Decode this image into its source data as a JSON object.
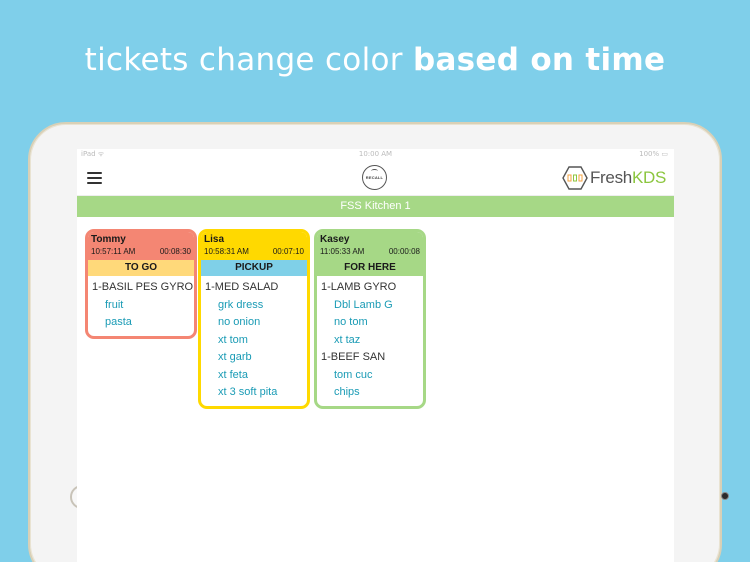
{
  "headline": {
    "normal": "tickets change color ",
    "bold": "based on time"
  },
  "statusbar": {
    "left": "iPad ᯤ",
    "center": "10:00 AM",
    "right": "100% ▭"
  },
  "navbar": {
    "recall_label": "RECALL",
    "brand_prefix": "Fresh",
    "brand_suffix": "KDS"
  },
  "kitchen": {
    "title": "FSS Kitchen 1"
  },
  "colors": {
    "red": "#f48673",
    "yellow": "#ffd900",
    "green": "#a6d886",
    "togo": "#ffd97a",
    "pickup": "#7fd0e8",
    "forhere": "#a6d886"
  },
  "tickets": [
    {
      "name": "Tommy",
      "time": "10:57:11 AM",
      "elapsed": "00:08:30",
      "type": "TO GO",
      "items": [
        {
          "name": "1-BASIL PES GYRO",
          "mods": [
            "fruit",
            "pasta"
          ]
        }
      ]
    },
    {
      "name": "Lisa",
      "time": "10:58:31 AM",
      "elapsed": "00:07:10",
      "type": "PICKUP",
      "items": [
        {
          "name": "1-MED SALAD",
          "mods": [
            "grk dress",
            "no onion",
            "xt tom",
            "xt garb",
            "xt feta",
            "xt 3 soft pita"
          ]
        }
      ]
    },
    {
      "name": "Kasey",
      "time": "11:05:33 AM",
      "elapsed": "00:00:08",
      "type": "FOR HERE",
      "items": [
        {
          "name": "1-LAMB GYRO",
          "mods": [
            "Dbl Lamb G",
            "no tom",
            "xt taz"
          ]
        },
        {
          "name": "1-BEEF SAN",
          "mods": [
            "tom cuc",
            "chips"
          ]
        }
      ]
    }
  ]
}
